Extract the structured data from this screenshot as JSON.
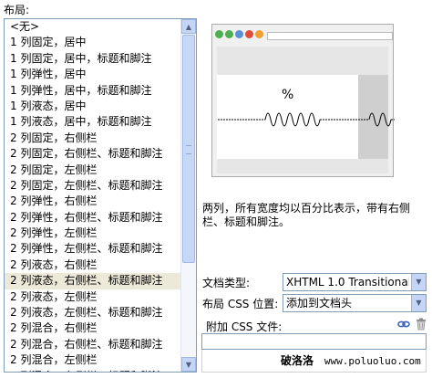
{
  "layout_label": "布局:",
  "layouts": [
    "<无>",
    "1 列固定，居中",
    "1 列固定，居中，标题和脚注",
    "1 列弹性，居中",
    "1 列弹性，居中，标题和脚注",
    "1 列液态，居中",
    "1 列液态，居中，标题和脚注",
    "2 列固定，右侧栏",
    "2 列固定，右侧栏、标题和脚注",
    "2 列固定，左侧栏",
    "2 列固定，左侧栏、标题和脚注",
    "2 列弹性，右侧栏",
    "2 列弹性，右侧栏、标题和脚注",
    "2 列弹性，左侧栏",
    "2 列弹性，左侧栏、标题和脚注",
    "2 列液态，右侧栏",
    "2 列液态，右侧栏、标题和脚注",
    "2 列液态，左侧栏",
    "2 列液态，左侧栏、标题和脚注",
    "2 列混合，右侧栏",
    "2 列混合，右侧栏、标题和脚注",
    "2 列混合，左侧栏",
    "2 列混合，左侧栏、标题和脚注"
  ],
  "selected_layout": "2 列液态，右侧栏、标题和脚注",
  "preview": {
    "percent_symbol": "%"
  },
  "description": "两列，所有宽度均以百分比表示，带有右侧栏、标题和脚注。",
  "doctype": {
    "label": "文档类型:",
    "value": "XHTML 1.0 Transitional"
  },
  "css_location": {
    "label": "布局 CSS 位置:",
    "value": "添加到文档头"
  },
  "attach_css": {
    "label": "附加 CSS 文件:"
  },
  "watermark": {
    "brand": "破洛洛",
    "url": "www.poluoluo.com"
  },
  "colors": {
    "selection": "#ece9d8",
    "border": "#7f9db9",
    "scrollbar": "#c4d5f6"
  }
}
